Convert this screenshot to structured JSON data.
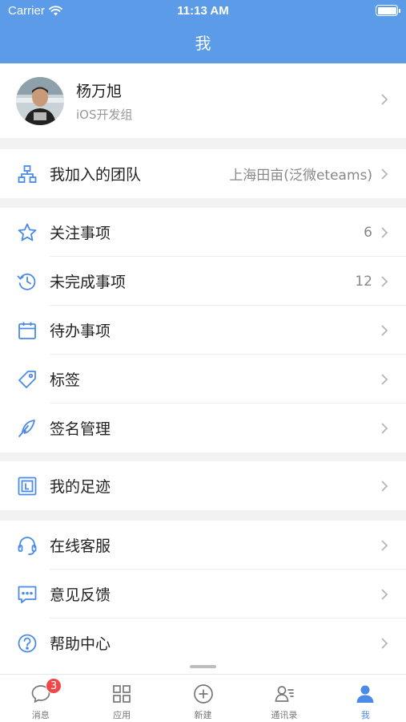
{
  "status_bar": {
    "carrier": "Carrier",
    "time": "11:13 AM"
  },
  "nav": {
    "title": "我"
  },
  "profile": {
    "name": "杨万旭",
    "department": "iOS开发组"
  },
  "team_section": {
    "label": "我加入的团队",
    "value": "上海田亩(泛微eteams)",
    "icon": "team-icon"
  },
  "items_section": [
    {
      "label": "关注事项",
      "value": "6",
      "icon": "star-icon"
    },
    {
      "label": "未完成事项",
      "value": "12",
      "icon": "history-icon"
    },
    {
      "label": "待办事项",
      "value": "",
      "icon": "calendar-icon"
    },
    {
      "label": "标签",
      "value": "",
      "icon": "tag-icon"
    },
    {
      "label": "签名管理",
      "value": "",
      "icon": "feather-icon"
    }
  ],
  "footprint_section": {
    "label": "我的足迹",
    "icon": "footprint-icon"
  },
  "support_section": [
    {
      "label": "在线客服",
      "icon": "headset-icon"
    },
    {
      "label": "意见反馈",
      "icon": "feedback-icon"
    },
    {
      "label": "帮助中心",
      "icon": "help-icon"
    }
  ],
  "tabbar": {
    "tabs": [
      {
        "label": "消息",
        "icon": "message-icon",
        "badge": "3"
      },
      {
        "label": "应用",
        "icon": "apps-icon"
      },
      {
        "label": "新建",
        "icon": "add-icon"
      },
      {
        "label": "通讯录",
        "icon": "contacts-icon"
      },
      {
        "label": "我",
        "icon": "me-icon",
        "active": true
      }
    ]
  },
  "colors": {
    "accent": "#5b9be8",
    "icon_blue": "#4a8ae8",
    "badge_red": "#f04848"
  }
}
